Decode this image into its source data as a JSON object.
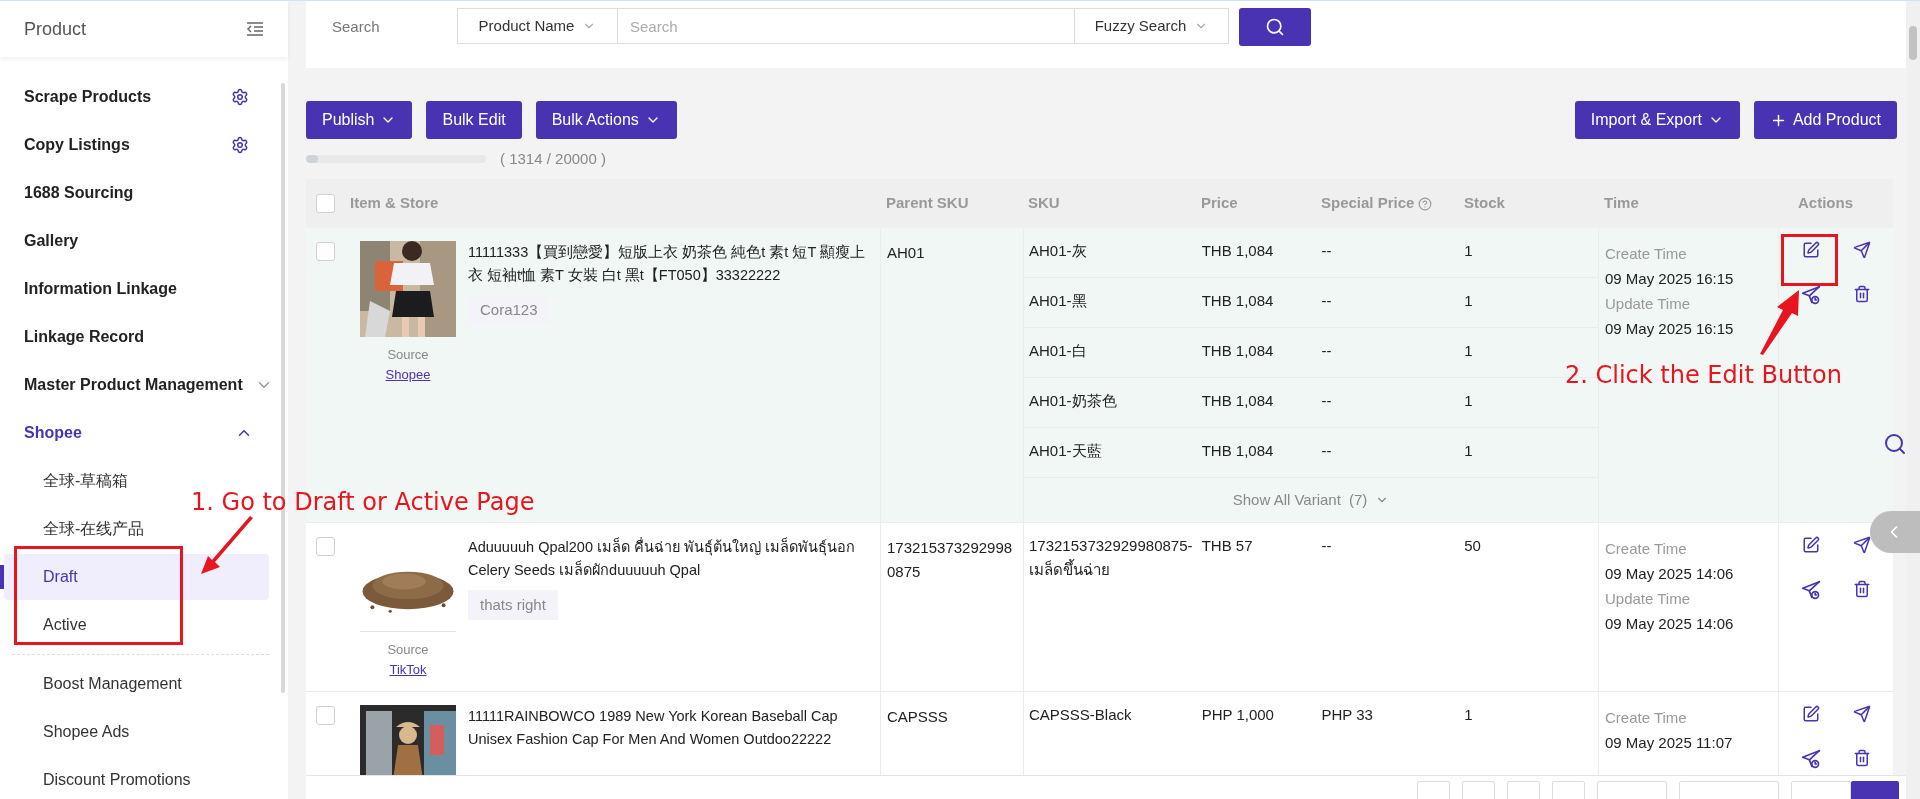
{
  "sidebar": {
    "title": "Product",
    "items": [
      {
        "label": "Scrape Products",
        "kind": "settings"
      },
      {
        "label": "Copy Listings",
        "kind": "settings"
      },
      {
        "label": "1688 Sourcing",
        "kind": "plain"
      },
      {
        "label": "Gallery",
        "kind": "plain"
      },
      {
        "label": "Information Linkage",
        "kind": "plain"
      },
      {
        "label": "Linkage Record",
        "kind": "plain"
      },
      {
        "label": "Master Product Management",
        "kind": "group",
        "expanded": false
      },
      {
        "label": "Shopee",
        "kind": "group",
        "expanded": true,
        "children": [
          {
            "label": "全球-草稿箱",
            "selected": false,
            "divider_before": false
          },
          {
            "label": "全球-在线产品",
            "selected": false,
            "divider_before": false
          },
          {
            "label": "Draft",
            "selected": true,
            "divider_before": false
          },
          {
            "label": "Active",
            "selected": false,
            "divider_before": false
          },
          {
            "label": "Boost Management",
            "selected": false,
            "divider_before": true
          },
          {
            "label": "Shopee Ads",
            "selected": false,
            "divider_before": false
          },
          {
            "label": "Discount Promotions",
            "selected": false,
            "divider_before": false
          }
        ]
      }
    ]
  },
  "search": {
    "label": "Search",
    "field": "Product Name",
    "placeholder": "Search",
    "mode": "Fuzzy Search"
  },
  "toolbar": {
    "left": [
      {
        "label": "Publish",
        "kind": "dropdown"
      },
      {
        "label": "Bulk Edit",
        "kind": "plain"
      },
      {
        "label": "Bulk Actions",
        "kind": "dropdown"
      }
    ],
    "right": [
      {
        "label": "Import & Export",
        "kind": "dropdown"
      },
      {
        "label": "Add Product",
        "kind": "add"
      }
    ]
  },
  "quota": {
    "text": "( 1314 / 20000 )",
    "level": 0.0657
  },
  "table": {
    "select_all": false,
    "columns": [
      {
        "label": "Item & Store",
        "kind": "plain"
      },
      {
        "label": "Parent SKU",
        "kind": "plain"
      },
      {
        "label": "SKU",
        "kind": "plain"
      },
      {
        "label": "Price",
        "kind": "plain"
      },
      {
        "label": "Special Price",
        "kind": "help"
      },
      {
        "label": "Stock",
        "kind": "plain"
      },
      {
        "label": "Time",
        "kind": "plain"
      },
      {
        "label": "Actions",
        "kind": "plain"
      }
    ],
    "rows": [
      {
        "checked": false,
        "highlighted": true,
        "title": "11111333【買到戀愛】短版上衣 奶茶色 純色t 素t 短T 顯瘦上衣 短袖t恤 素T 女裝 白t 黑t【FT050】33322222",
        "store": "Cora123",
        "source_label": "Source",
        "source": "Shopee",
        "parent_sku": "AH01",
        "variants": [
          {
            "sku": "AH01-灰",
            "price": "THB 1,084",
            "special_price": "--",
            "stock": "1"
          },
          {
            "sku": "AH01-黑",
            "price": "THB 1,084",
            "special_price": "--",
            "stock": "1"
          },
          {
            "sku": "AH01-白",
            "price": "THB 1,084",
            "special_price": "--",
            "stock": "1"
          },
          {
            "sku": "AH01-奶茶色",
            "price": "THB 1,084",
            "special_price": "--",
            "stock": "1"
          },
          {
            "sku": "AH01-天藍",
            "price": "THB 1,084",
            "special_price": "--",
            "stock": "1"
          }
        ],
        "show_all": "Show All Variant",
        "variant_count": "(7)",
        "create_label": "Create Time",
        "create_time": "09 May 2025 16:15",
        "update_label": "Update Time",
        "update_time": "09 May 2025 16:15"
      },
      {
        "checked": false,
        "highlighted": false,
        "title": "Aduuuuuh Qpal200 เมล็ด คื่นฉ่าย พันธุ์ต้นใหญ่ เมล็ดพันธุ์นอก Celery Seeds เมล็ดผักduuuuuh Qpal",
        "store": "thats right",
        "source_label": "Source",
        "source": "TikTok",
        "parent_sku": "1732153732929980875",
        "variants": [
          {
            "sku": "1732153732929980875-เมล็ดขึ้นฉ่าย",
            "price": "THB 57",
            "special_price": "--",
            "stock": "50"
          }
        ],
        "create_label": "Create Time",
        "create_time": "09 May 2025 14:06",
        "update_label": "Update Time",
        "update_time": "09 May 2025 14:06"
      },
      {
        "checked": false,
        "highlighted": false,
        "title": "11111RAINBOWCO 1989 New York Korean Baseball Cap Unisex Fashion Cap For Men And Women Outdoo22222",
        "parent_sku": "CAPSSS",
        "variants": [
          {
            "sku": "CAPSSS-Black",
            "price": "PHP 1,000",
            "special_price": "PHP 33",
            "stock": "1"
          }
        ],
        "create_label": "Create Time",
        "create_time": "09 May 2025 11:07"
      }
    ]
  },
  "annotations": [
    {
      "text": "1. Go to Draft or Active Page"
    },
    {
      "text": "2. Click the Edit Button"
    }
  ]
}
